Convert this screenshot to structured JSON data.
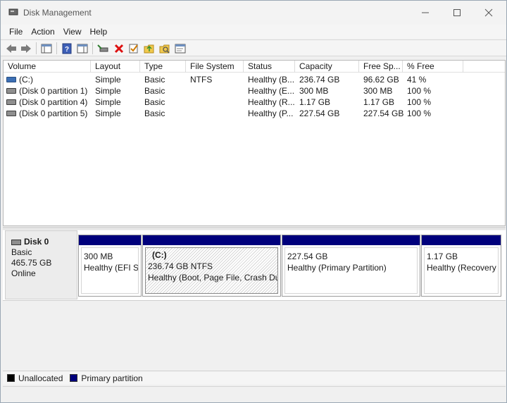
{
  "window": {
    "title": "Disk Management"
  },
  "menu": [
    "File",
    "Action",
    "View",
    "Help"
  ],
  "columns": [
    "Volume",
    "Layout",
    "Type",
    "File System",
    "Status",
    "Capacity",
    "Free Sp...",
    "% Free"
  ],
  "volumes": [
    {
      "volume": "(C:)",
      "layout": "Simple",
      "type": "Basic",
      "fs": "NTFS",
      "status": "Healthy (B...",
      "capacity": "236.74 GB",
      "free": "96.62 GB",
      "pct": "41 %"
    },
    {
      "volume": "(Disk 0 partition 1)",
      "layout": "Simple",
      "type": "Basic",
      "fs": "",
      "status": "Healthy (E...",
      "capacity": "300 MB",
      "free": "300 MB",
      "pct": "100 %"
    },
    {
      "volume": "(Disk 0 partition 4)",
      "layout": "Simple",
      "type": "Basic",
      "fs": "",
      "status": "Healthy (R...",
      "capacity": "1.17 GB",
      "free": "1.17 GB",
      "pct": "100 %"
    },
    {
      "volume": "(Disk 0 partition 5)",
      "layout": "Simple",
      "type": "Basic",
      "fs": "",
      "status": "Healthy (P...",
      "capacity": "227.54 GB",
      "free": "227.54 GB",
      "pct": "100 %"
    }
  ],
  "disk": {
    "name": "Disk 0",
    "type": "Basic",
    "size": "465.75 GB",
    "state": "Online"
  },
  "partitions": [
    {
      "label": "",
      "line1": "300 MB",
      "line2": "Healthy (EFI Sy"
    },
    {
      "label": "(C:)",
      "line1": "236.74 GB NTFS",
      "line2": "Healthy (Boot, Page File, Crash Dum"
    },
    {
      "label": "",
      "line1": "227.54 GB",
      "line2": "Healthy (Primary Partition)"
    },
    {
      "label": "",
      "line1": "1.17 GB",
      "line2": "Healthy (Recovery P"
    }
  ],
  "legend": [
    {
      "label": "Unallocated",
      "color": "#000000"
    },
    {
      "label": "Primary partition",
      "color": "#00007c"
    }
  ]
}
